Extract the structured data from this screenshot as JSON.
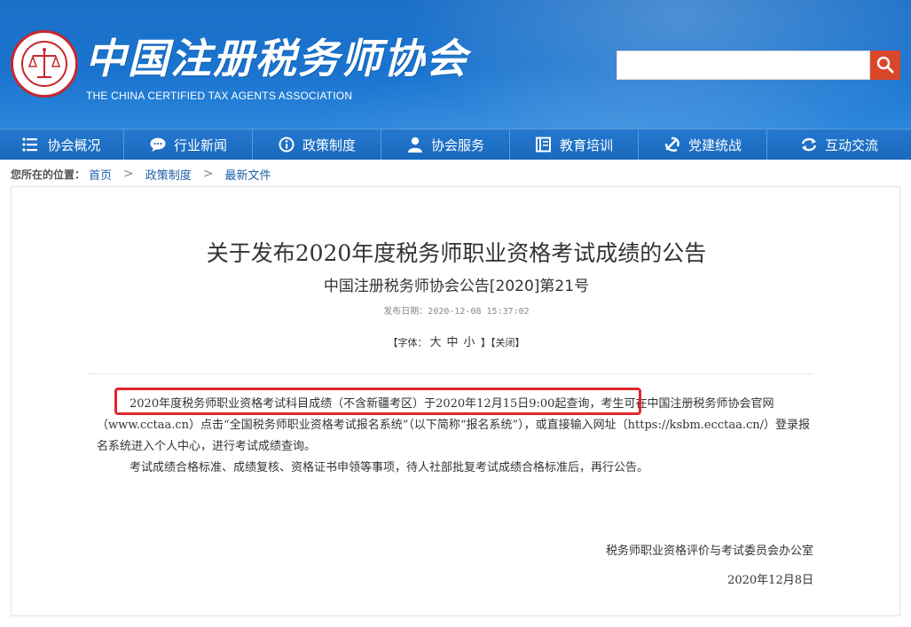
{
  "header": {
    "title_cn": "中国注册税务师协会",
    "title_en": "THE CHINA CERTIFIED TAX AGENTS ASSOCIATION",
    "search_value": "",
    "search_icon": "search-icon",
    "colors": {
      "header_blue": "#1a74cf",
      "search_button": "#d9472b"
    }
  },
  "nav": {
    "items": [
      {
        "label": "协会概况",
        "icon": "list-icon"
      },
      {
        "label": "行业新闻",
        "icon": "chat-icon"
      },
      {
        "label": "政策制度",
        "icon": "info-icon"
      },
      {
        "label": "协会服务",
        "icon": "user-icon"
      },
      {
        "label": "教育培训",
        "icon": "book-icon"
      },
      {
        "label": "党建统战",
        "icon": "party-icon"
      },
      {
        "label": "互动交流",
        "icon": "refresh-icon"
      }
    ]
  },
  "breadcrumb": {
    "lead": "您所在的位置：",
    "items": [
      "首页",
      "政策制度",
      "最新文件"
    ],
    "separator": ">"
  },
  "article": {
    "title": "关于发布2020年度税务师职业资格考试成绩的公告",
    "subtitle": "中国注册税务师协会公告[2020]第21号",
    "pubdate": "发布日期：2020-12-08 15:37:02",
    "tools": {
      "open": "【",
      "font_label": "字体：",
      "large": "大",
      "medium": "中",
      "small": "小",
      "mid": " 】【",
      "close_label": "关闭",
      "end": "】"
    },
    "paragraphs": [
      "2020年度税务师职业资格考试科目成绩（不含新疆考区）于2020年12月15日9:00起查询，考生可在中国注册税务师协会官网（www.cctaa.cn）点击“全国税务师职业资格考试报名系统”（以下简称“报名系统”），或直接输入网址（https://ksbm.ecctaa.cn/）登录报名系统进入个人中心，进行考试成绩查询。",
      "考试成绩合格标准、成绩复核、资格证书申领等事项，待人社部批复考试成绩合格标准后，再行公告。"
    ],
    "signature": "税务师职业资格评价与考试委员会办公室",
    "date": "2020年12月8日",
    "highlight_color": "#e0282d"
  }
}
